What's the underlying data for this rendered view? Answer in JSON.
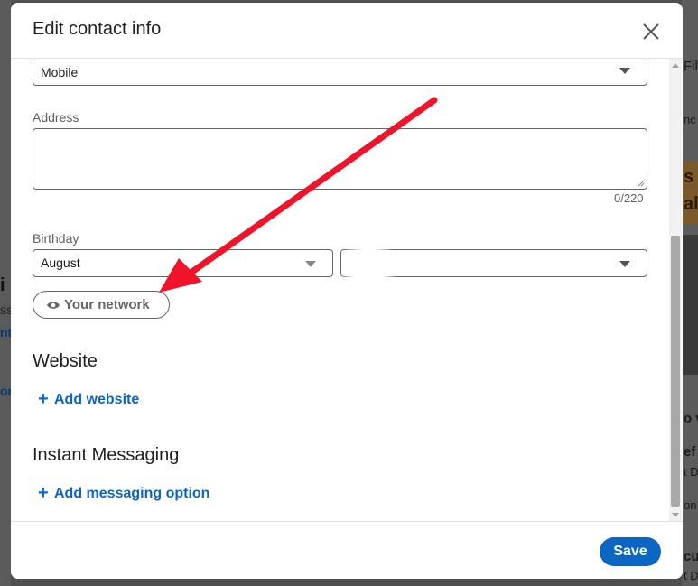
{
  "dialog": {
    "title": "Edit contact info",
    "close_icon": "close-icon"
  },
  "phone": {
    "type_value": "Mobile"
  },
  "address": {
    "label": "Address",
    "value": "",
    "counter": "0/220"
  },
  "birthday": {
    "label": "Birthday",
    "month": "August",
    "day": ""
  },
  "visibility": {
    "icon": "eye-icon",
    "label": "Your network"
  },
  "website": {
    "heading": "Website",
    "add_label": "Add website"
  },
  "messaging": {
    "heading": "Instant Messaging",
    "add_label": "Add messaging option"
  },
  "footer": {
    "save_label": "Save"
  },
  "background": {
    "right_fragments": [
      "Fil",
      "nc",
      "s b",
      "alm",
      "o v",
      "ef",
      "t D",
      "on",
      "cus",
      "t D"
    ],
    "left_fragments": [
      "i",
      "ss",
      "nt",
      "or"
    ]
  },
  "colors": {
    "accent": "#0a66c2",
    "annotation_arrow": "#f0142a"
  }
}
